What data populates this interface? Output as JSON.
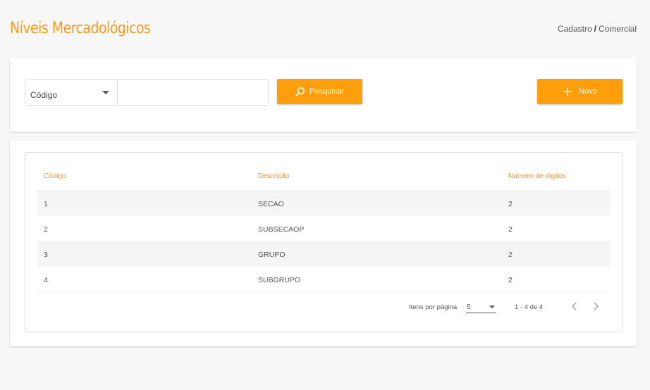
{
  "header": {
    "title": "Níveis Mercadológicos",
    "breadcrumb": {
      "parent": "Cadastro",
      "separator": "/",
      "current": "Comercial"
    }
  },
  "search": {
    "field_selected": "Código",
    "input_value": "",
    "search_label": "Pesquisar",
    "new_label": "Novo"
  },
  "table": {
    "headers": {
      "code": "Código",
      "description": "Descrição",
      "digits": "Número de dígitos"
    },
    "rows": [
      {
        "code": "1",
        "description": "SECAO",
        "digits": "2"
      },
      {
        "code": "2",
        "description": "SUBSECAOP",
        "digits": "2"
      },
      {
        "code": "3",
        "description": "GRUPO",
        "digits": "2"
      },
      {
        "code": "4",
        "description": "SUBGRUPO",
        "digits": "2"
      }
    ]
  },
  "pagination": {
    "items_per_page_label": "Itens por página",
    "items_per_page_value": "5",
    "range": "1 - 4 de 4"
  },
  "colors": {
    "accent": "#ff9e0d",
    "title": "#f79a1e"
  }
}
